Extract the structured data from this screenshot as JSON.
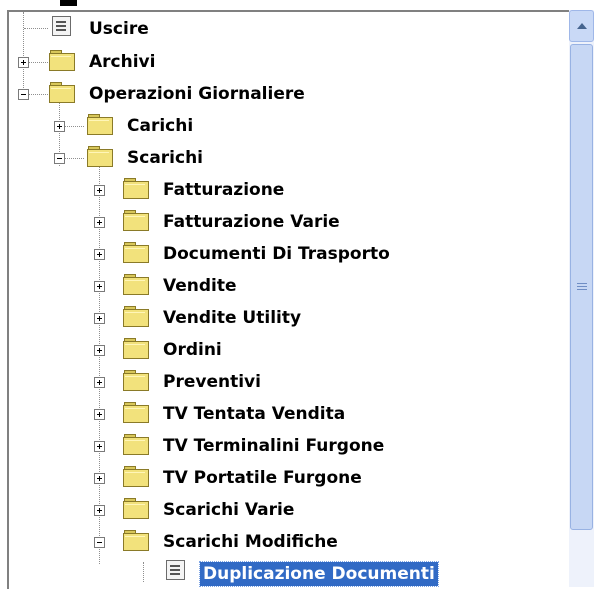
{
  "tree": {
    "items": [
      {
        "label": "Uscire",
        "type": "document"
      },
      {
        "label": "Archivi",
        "type": "folder",
        "expanded": false
      },
      {
        "label": "Operazioni Giornaliere",
        "type": "folder",
        "expanded": true
      },
      {
        "label": "Carichi",
        "type": "folder",
        "expanded": false
      },
      {
        "label": "Scarichi",
        "type": "folder",
        "expanded": true
      },
      {
        "label": "Fatturazione",
        "type": "folder",
        "expanded": false
      },
      {
        "label": "Fatturazione Varie",
        "type": "folder",
        "expanded": false
      },
      {
        "label": "Documenti Di Trasporto",
        "type": "folder",
        "expanded": false
      },
      {
        "label": "Vendite",
        "type": "folder",
        "expanded": false
      },
      {
        "label": "Vendite Utility",
        "type": "folder",
        "expanded": false
      },
      {
        "label": "Ordini",
        "type": "folder",
        "expanded": false
      },
      {
        "label": "Preventivi",
        "type": "folder",
        "expanded": false
      },
      {
        "label": "TV Tentata Vendita",
        "type": "folder",
        "expanded": false
      },
      {
        "label": "TV Terminalini Furgone",
        "type": "folder",
        "expanded": false
      },
      {
        "label": "TV Portatile Furgone",
        "type": "folder",
        "expanded": false
      },
      {
        "label": "Scarichi Varie",
        "type": "folder",
        "expanded": false
      },
      {
        "label": "Scarichi Modifiche",
        "type": "folder",
        "expanded": true
      },
      {
        "label": "Duplicazione Documenti",
        "type": "document",
        "selected": true
      }
    ]
  },
  "colors": {
    "selection": "#316ac5",
    "folder": "#f2e27c"
  }
}
